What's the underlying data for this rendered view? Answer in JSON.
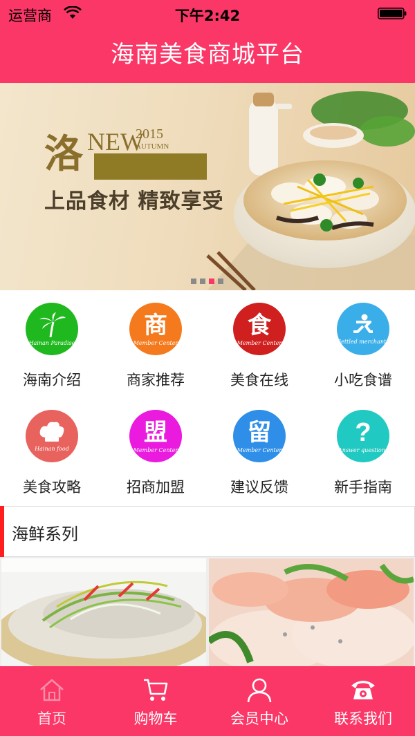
{
  "status_bar": {
    "carrier": "运营商",
    "time": "下午2:42"
  },
  "header": {
    "title": "海南美食商城平台"
  },
  "banner": {
    "brand_char": "洛",
    "new_text": "NEW",
    "year": "2015",
    "season": "AUTUMN",
    "tagline": "上品食材 精致享受",
    "carousel_count": 4,
    "carousel_active_index": 2
  },
  "grid": [
    {
      "label": "海南介绍",
      "icon": "palm-tree-icon",
      "glyph": "",
      "sub": "Hainan Paradise",
      "color": "#1fb91f"
    },
    {
      "label": "商家推荐",
      "icon": "merchant-icon",
      "glyph": "商",
      "sub": "Member Center",
      "color": "#f47a1d"
    },
    {
      "label": "美食在线",
      "icon": "food-icon",
      "glyph": "食",
      "sub": "Member Center",
      "color": "#cf1f1f"
    },
    {
      "label": "小吃食谱",
      "icon": "runner-icon",
      "glyph": "",
      "sub": "Settled merchants",
      "color": "#3aaee8"
    },
    {
      "label": "美食攻略",
      "icon": "chef-hat-icon",
      "glyph": "",
      "sub": "Hainan food",
      "color": "#e8625e"
    },
    {
      "label": "招商加盟",
      "icon": "league-icon",
      "glyph": "盟",
      "sub": "Member Center",
      "color": "#ea1adf"
    },
    {
      "label": "建议反馈",
      "icon": "feedback-icon",
      "glyph": "留",
      "sub": "Member Center",
      "color": "#2f8fe8"
    },
    {
      "label": "新手指南",
      "icon": "question-icon",
      "glyph": "?",
      "sub": "Answer questions",
      "color": "#20c9c1"
    }
  ],
  "section": {
    "title": "海鲜系列"
  },
  "tabbar": [
    {
      "label": "首页",
      "icon": "home-icon"
    },
    {
      "label": "购物车",
      "icon": "cart-icon"
    },
    {
      "label": "会员中心",
      "icon": "user-icon"
    },
    {
      "label": "联系我们",
      "icon": "phone-icon"
    }
  ],
  "colors": {
    "brand": "#fb3767",
    "section_accent": "#ff1d1d"
  }
}
